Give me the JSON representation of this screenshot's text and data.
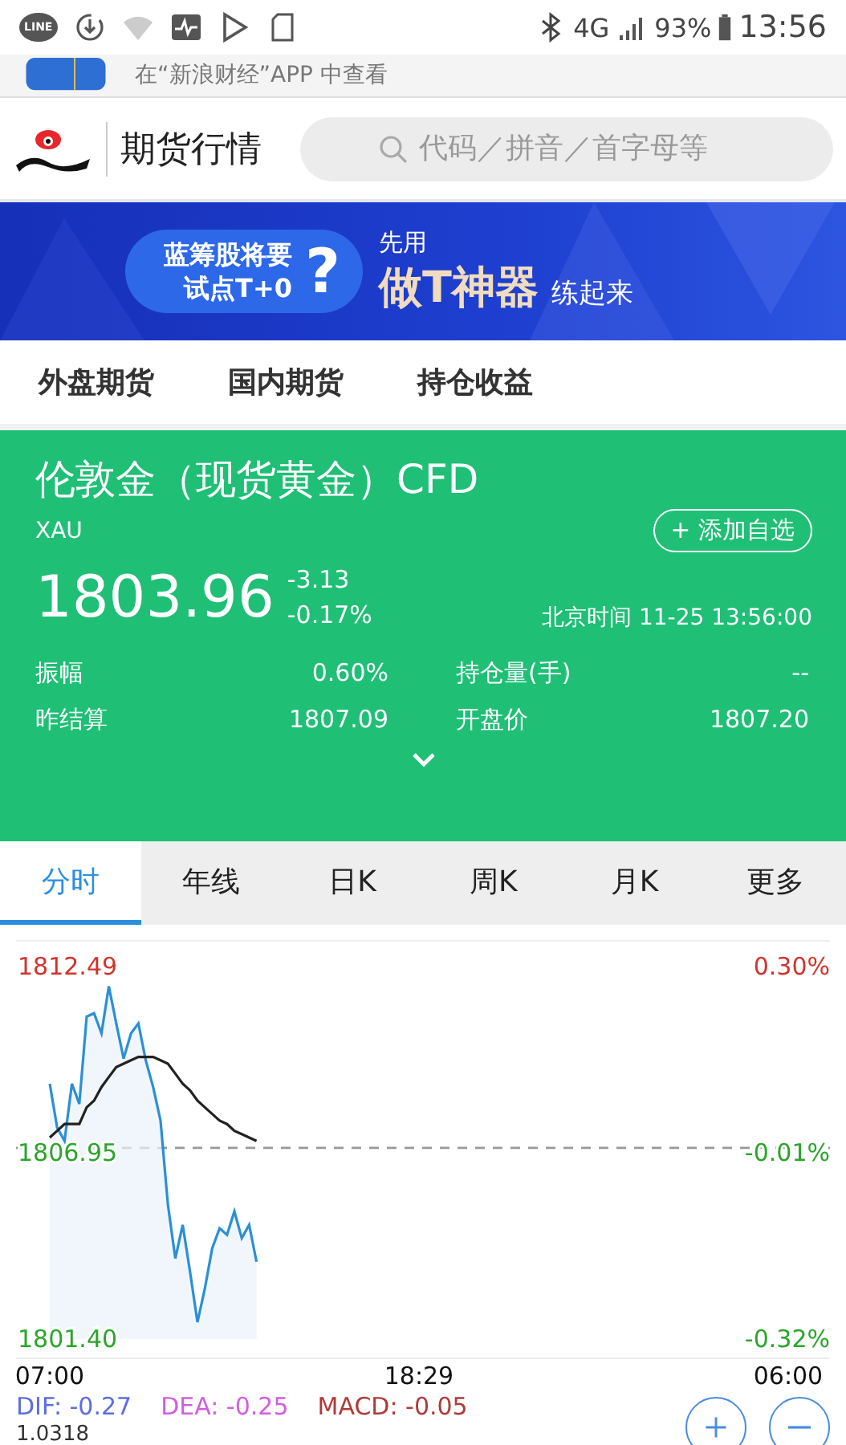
{
  "status_bar": {
    "app_label": "LINE",
    "network": "4G",
    "battery": "93%",
    "time": "13:56"
  },
  "app_prompt": {
    "text": "在“新浪财经”APP 中查看"
  },
  "header": {
    "title": "期货行情",
    "search": {
      "placeholder": "代码／拼音／首字母等"
    }
  },
  "ad_banner": {
    "bubble_lines": [
      "蓝筹股将要",
      "试点T+0"
    ],
    "question": "?",
    "lead": "先用",
    "headline": "做T神器",
    "tail": "练起来"
  },
  "nav_tabs": [
    {
      "label": "外盘期货"
    },
    {
      "label": "国内期货"
    },
    {
      "label": "持仓收益"
    }
  ],
  "quote": {
    "name": "伦敦金（现货黄金）CFD",
    "code": "XAU",
    "add_button": "+ 添加自选",
    "price": "1803.96",
    "change": "-3.13",
    "change_pct": "-0.17%",
    "time": "北京时间 11-25 13:56:00",
    "stats": [
      {
        "label": "振幅",
        "value": "0.60%"
      },
      {
        "label": "持仓量(手)",
        "value": "--"
      },
      {
        "label": "昨结算",
        "value": "1807.09"
      },
      {
        "label": "开盘价",
        "value": "1807.20"
      }
    ]
  },
  "period_tabs": [
    {
      "label": "分时",
      "selected": true
    },
    {
      "label": "年线",
      "selected": false
    },
    {
      "label": "日K",
      "selected": false
    },
    {
      "label": "周K",
      "selected": false
    },
    {
      "label": "月K",
      "selected": false
    },
    {
      "label": "更多",
      "selected": false
    }
  ],
  "chart": {
    "percent_labels": [
      "0.30%",
      "-0.01%",
      "-0.32%"
    ],
    "chart_data": {
      "type": "line",
      "categories": [
        "07:00",
        null,
        null,
        null,
        null,
        null,
        null,
        null,
        null,
        null,
        null,
        null,
        null,
        null,
        null,
        null,
        null,
        null,
        null,
        null,
        null,
        null,
        null,
        null,
        null,
        null,
        null,
        null,
        null,
        null,
        null,
        null,
        null,
        null,
        null,
        null,
        null,
        null,
        null,
        null,
        null,
        null,
        null,
        null,
        null,
        null,
        null,
        null,
        null,
        null,
        "18:29",
        null,
        null,
        null,
        null,
        null,
        null,
        null,
        null,
        null,
        null,
        null,
        null,
        null,
        null,
        null,
        null,
        null,
        null,
        null,
        null,
        null,
        null,
        null,
        null,
        null,
        null,
        null,
        null,
        null,
        null,
        null,
        null,
        null,
        null,
        null,
        null,
        null,
        null,
        null,
        null,
        null,
        null,
        null,
        null,
        null,
        null,
        null,
        null,
        null,
        "06:00"
      ],
      "series": [
        {
          "color": "#2b8fd6",
          "values": [
            1809.0,
            1807.7,
            1807.3,
            1809.0,
            1808.4,
            1811.0,
            1811.1,
            1810.5,
            1811.9,
            1810.8,
            1809.75,
            1810.5,
            1810.8,
            1809.7,
            1808.9,
            1807.9,
            1805.4,
            1803.8,
            1804.8,
            1803.4,
            1801.9,
            1802.9,
            1804.1,
            1804.7,
            1804.5,
            1805.2,
            1804.4,
            1804.8,
            1803.7,
            null,
            null,
            null,
            null,
            null,
            null,
            null,
            null,
            null,
            null,
            null,
            null,
            null,
            null,
            null,
            null,
            null,
            null,
            null,
            null,
            null,
            null,
            null,
            null,
            null,
            null,
            null,
            null,
            null,
            null,
            null,
            null,
            null,
            null,
            null,
            null,
            null,
            null,
            null,
            null,
            null,
            null,
            null,
            null,
            null,
            null,
            null,
            null,
            null,
            null,
            null,
            null,
            null,
            null,
            null,
            null,
            null,
            null,
            null,
            null,
            null,
            null,
            null,
            null,
            null,
            null,
            null,
            null,
            null,
            null,
            null,
            null
          ]
        },
        {
          "color": "#222222",
          "values": [
            1807.4,
            1807.6,
            1807.8,
            1807.8,
            1807.8,
            1808.3,
            1808.5,
            1808.9,
            1809.2,
            1809.5,
            1809.6,
            1809.7,
            1809.8,
            1809.8,
            1809.8,
            1809.7,
            1809.6,
            1809.3,
            1809.0,
            1808.8,
            1808.5,
            1808.3,
            1808.1,
            1807.9,
            1807.8,
            1807.6,
            1807.5,
            1807.4,
            1807.3,
            null,
            null,
            null,
            null,
            null,
            null,
            null,
            null,
            null,
            null,
            null,
            null,
            null,
            null,
            null,
            null,
            null,
            null,
            null,
            null,
            null,
            null,
            null,
            null,
            null,
            null,
            null,
            null,
            null,
            null,
            null,
            null,
            null,
            null,
            null,
            null,
            null,
            null,
            null,
            null,
            null,
            null,
            null,
            null,
            null,
            null,
            null,
            null,
            null,
            null,
            null,
            null,
            null,
            null,
            null,
            null,
            null,
            null,
            null,
            null,
            null,
            null,
            null,
            null,
            null,
            null,
            null,
            null,
            null,
            null,
            null,
            null
          ]
        }
      ],
      "ylim": [
        1801.4,
        1812.49
      ],
      "yticks": [
        {
          "value": 1812.49,
          "label": "1812.49"
        },
        {
          "value": 1806.95,
          "label": "1806.95"
        },
        {
          "value": 1801.4,
          "label": "1801.40"
        }
      ],
      "stacked": false
    }
  },
  "indicators": [
    {
      "text": "DIF: -0.27",
      "color": "#5b6ee1"
    },
    {
      "text": "DEA: -0.25",
      "color": "#d25ee0"
    },
    {
      "text": "MACD: -0.05",
      "color": "#b03a3a"
    }
  ],
  "indicator_scale": "1.0318"
}
